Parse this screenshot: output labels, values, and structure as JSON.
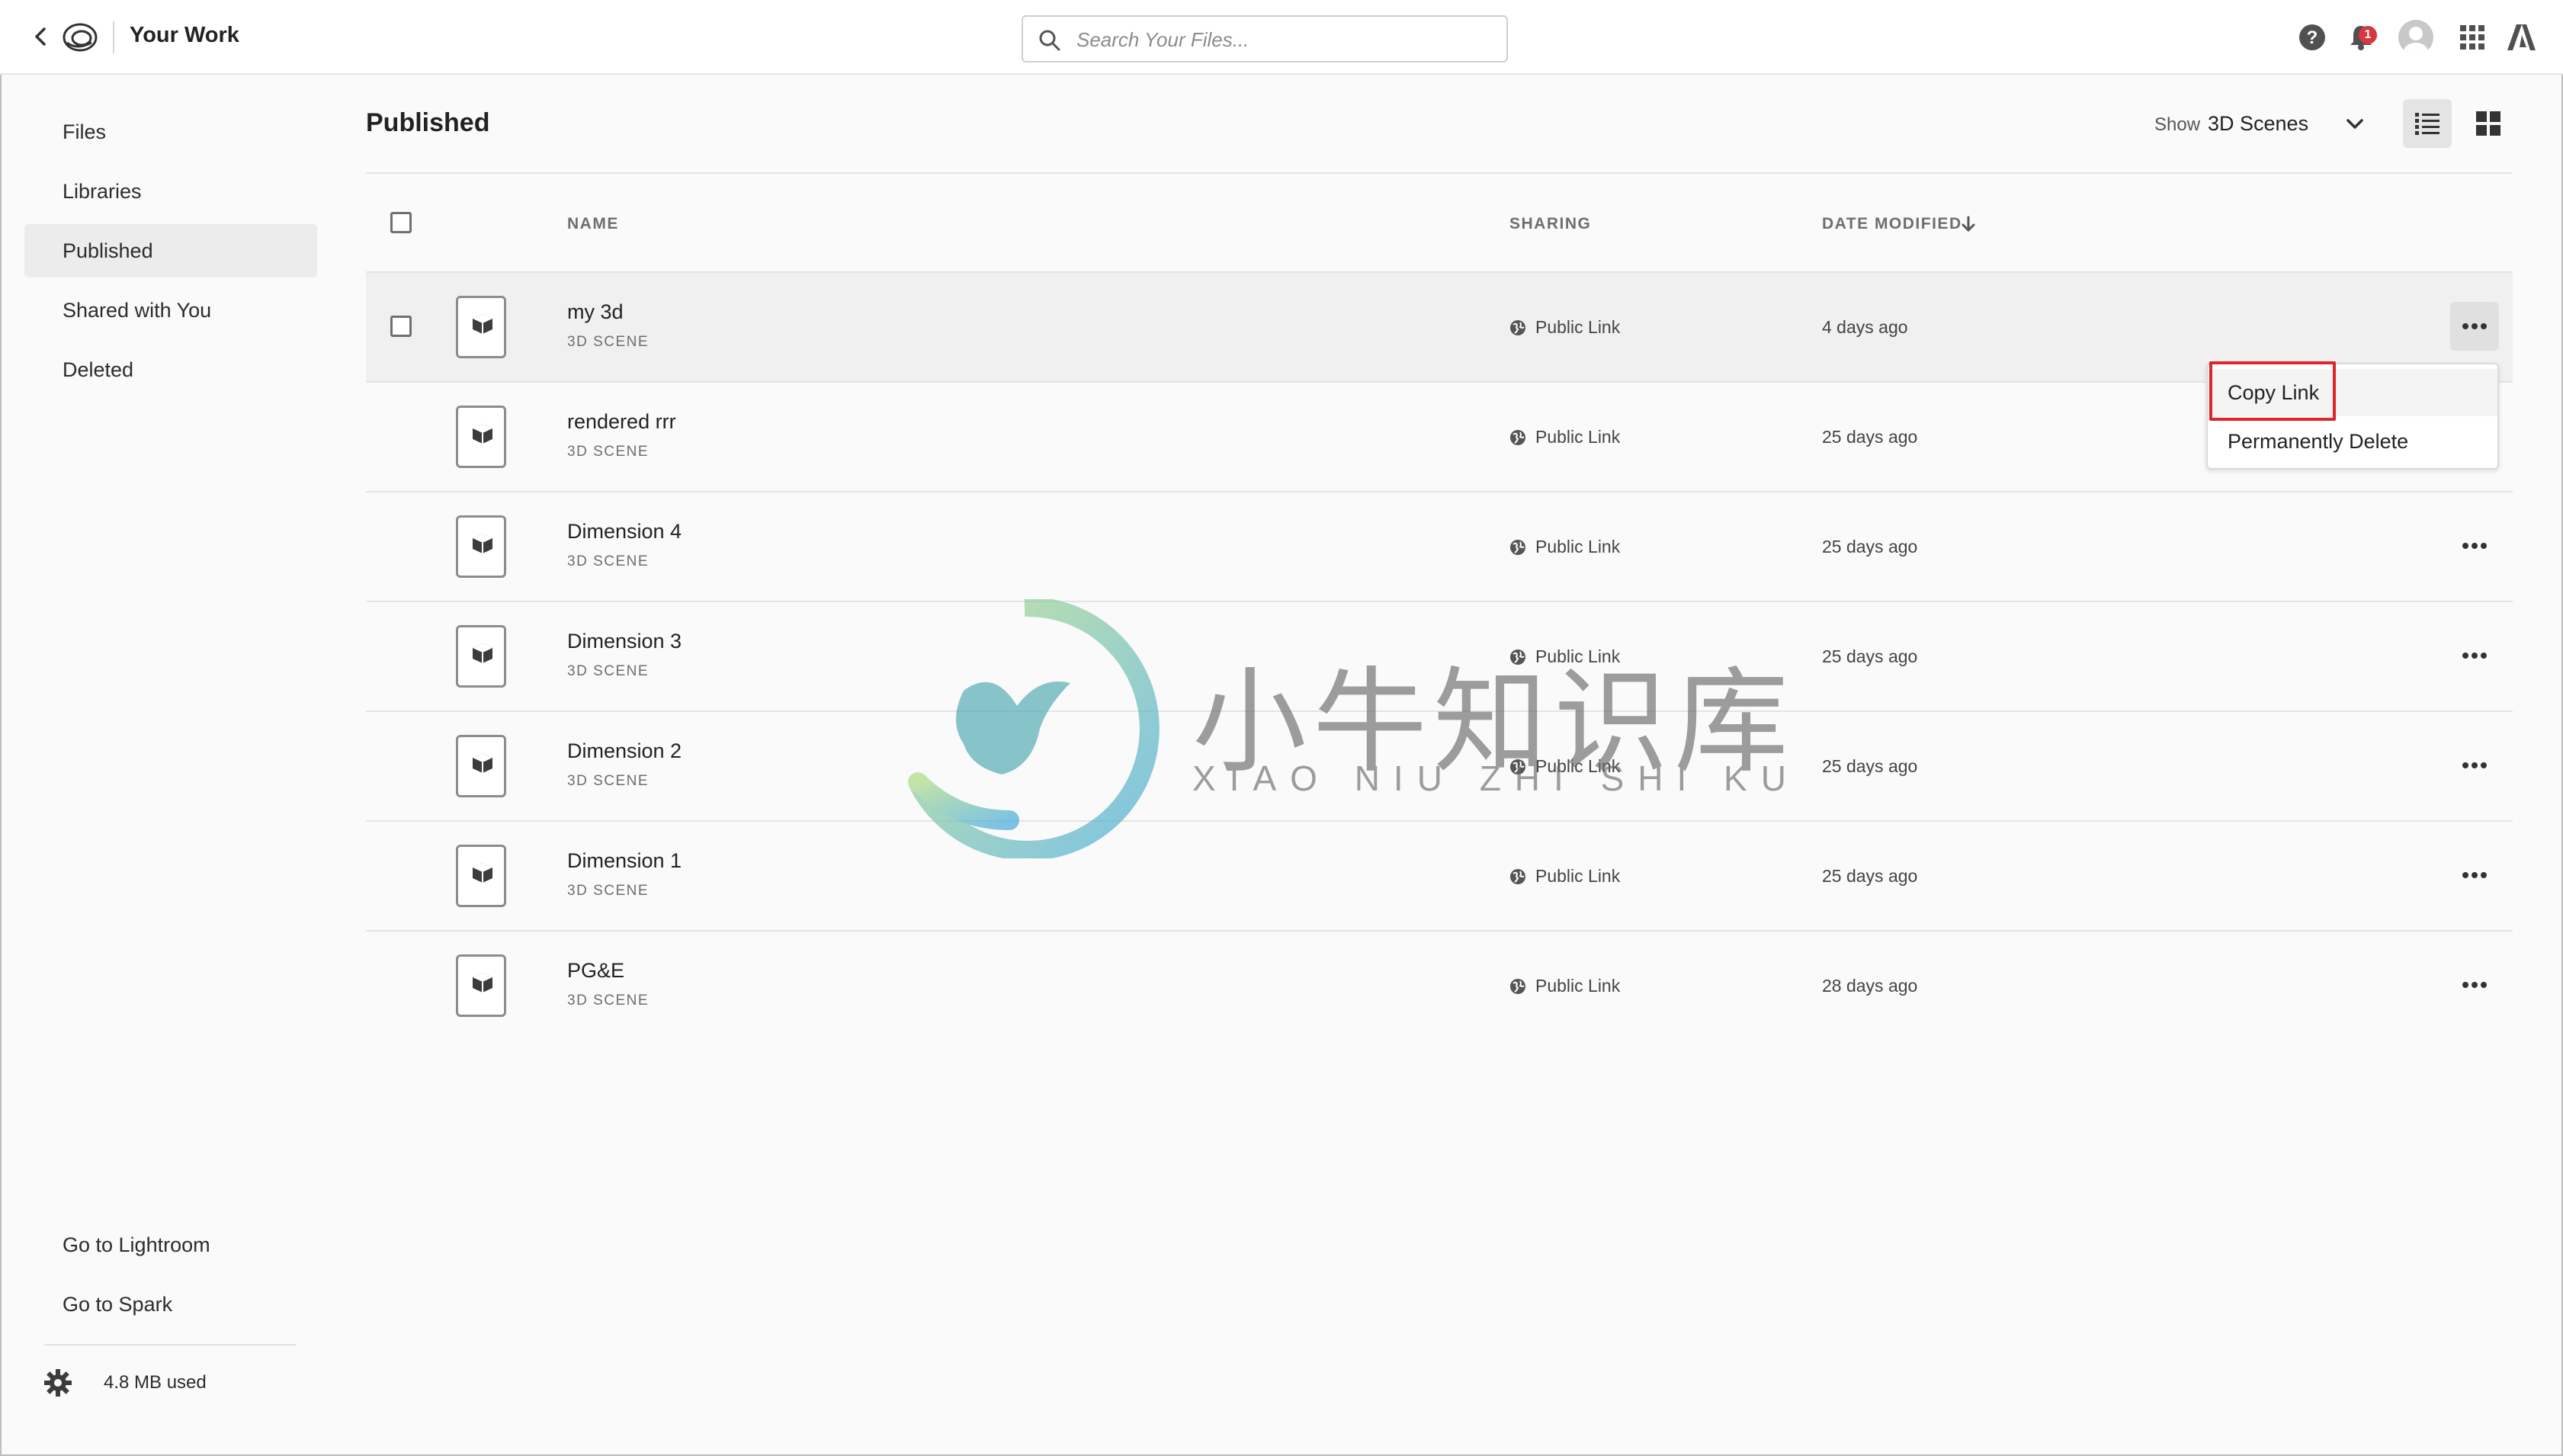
{
  "header": {
    "title": "Your Work",
    "search_placeholder": "Search Your Files...",
    "notification_count": "1",
    "icons": [
      "back-chevron-icon",
      "creative-cloud-logo-icon",
      "search-icon",
      "help-icon",
      "bell-icon",
      "avatar",
      "apps-grid-icon",
      "adobe-logo-icon"
    ]
  },
  "sidebar": {
    "items": [
      {
        "label": "Files"
      },
      {
        "label": "Libraries"
      },
      {
        "label": "Published",
        "active": true
      },
      {
        "label": "Shared with You"
      },
      {
        "label": "Deleted"
      }
    ],
    "links": [
      {
        "label": "Go to Lightroom"
      },
      {
        "label": "Go to Spark"
      }
    ],
    "storage": "4.8 MB used"
  },
  "main": {
    "title": "Published",
    "show_label": "Show",
    "show_value": "3D Scenes",
    "columns": {
      "name": "NAME",
      "sharing": "SHARING",
      "date": "DATE MODIFIED"
    },
    "rows": [
      {
        "name": "my 3d",
        "type": "3D SCENE",
        "sharing": "Public Link",
        "date": "4 days ago"
      },
      {
        "name": "rendered rrr",
        "type": "3D SCENE",
        "sharing": "Public Link",
        "date": "25 days ago"
      },
      {
        "name": "Dimension 4",
        "type": "3D SCENE",
        "sharing": "Public Link",
        "date": "25 days ago"
      },
      {
        "name": "Dimension 3",
        "type": "3D SCENE",
        "sharing": "Public Link",
        "date": "25 days ago"
      },
      {
        "name": "Dimension 2",
        "type": "3D SCENE",
        "sharing": "Public Link",
        "date": "25 days ago"
      },
      {
        "name": "Dimension 1",
        "type": "3D SCENE",
        "sharing": "Public Link",
        "date": "25 days ago"
      },
      {
        "name": "PG&E",
        "type": "3D SCENE",
        "sharing": "Public Link",
        "date": "28 days ago"
      }
    ]
  },
  "context_menu": {
    "items": [
      {
        "label": "Copy Link"
      },
      {
        "label": "Permanently Delete"
      }
    ]
  },
  "watermark": {
    "chinese": "小牛知识库",
    "latin": "XIAO NIU ZHI SHI KU"
  },
  "colors": {
    "highlight": "#e0242b",
    "badge": "#d7373f",
    "active_item": "#ececec"
  }
}
